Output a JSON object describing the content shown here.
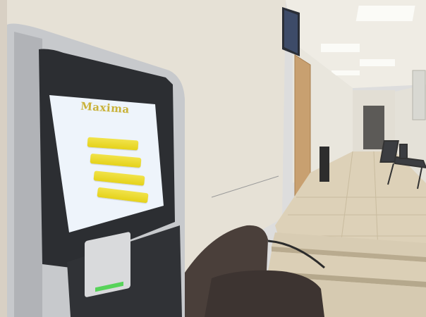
{
  "kiosk": {
    "logo_text": "Maxima",
    "prompt_text": "",
    "buttons": [
      {
        "label": ""
      },
      {
        "label": ""
      },
      {
        "label": ""
      },
      {
        "label": ""
      }
    ],
    "accent_color": "#e8d828",
    "screen_bg": "#eef4fb"
  },
  "scene": {
    "objects": [
      "queue-ticket-kiosk",
      "bench",
      "corridor",
      "ceiling-lights",
      "wall-monitor",
      "chairs",
      "stairs",
      "door"
    ]
  }
}
